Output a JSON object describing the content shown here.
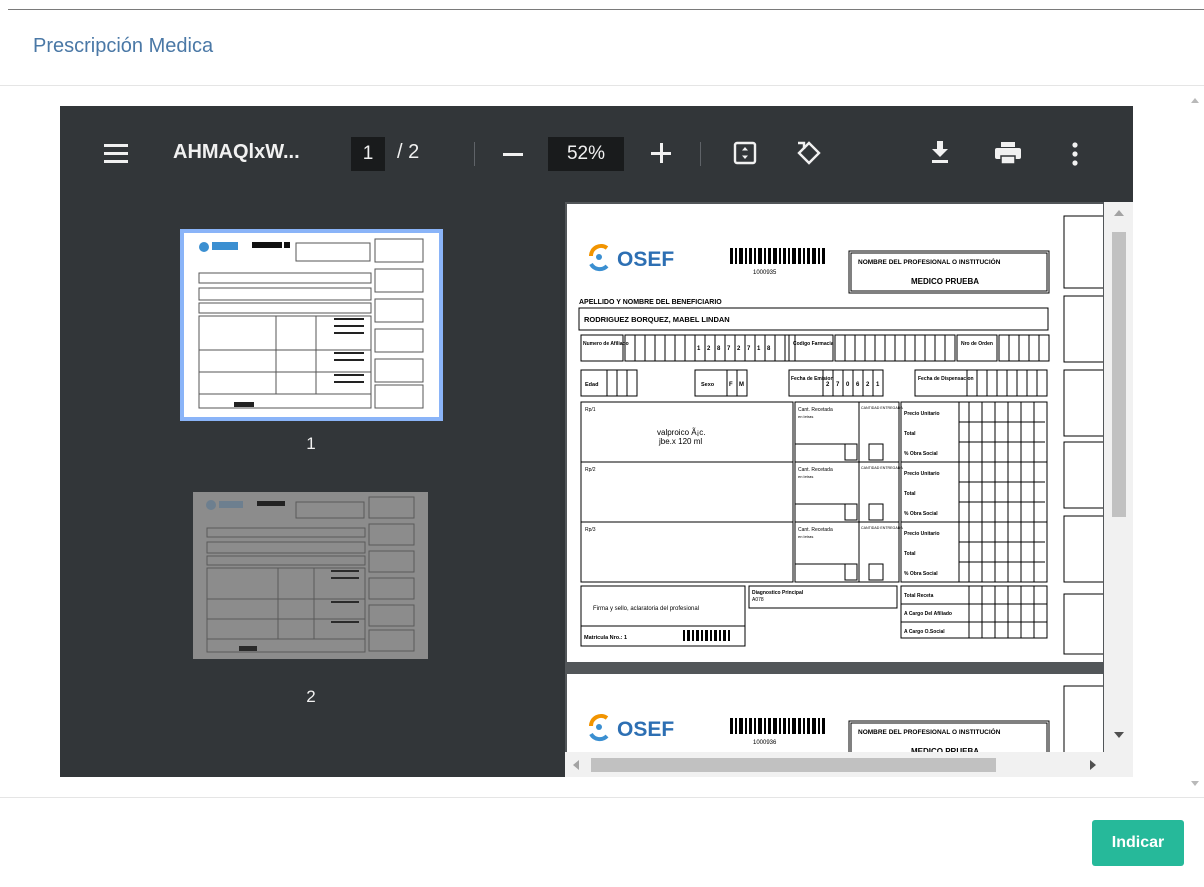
{
  "modal": {
    "title": "Prescripción Medica",
    "submit_label": "Indicar"
  },
  "viewer": {
    "doc_title": "AHMAQlxW...",
    "current_page": "1",
    "page_total": "/ 2",
    "zoom": "52%",
    "thumbnails": [
      {
        "label": "1"
      },
      {
        "label": "2"
      }
    ],
    "icons": [
      "menu-icon",
      "zoom-out-icon",
      "zoom-in-icon",
      "fit-page-icon",
      "rotate-icon",
      "download-icon",
      "print-icon",
      "more-options-icon"
    ]
  },
  "document": {
    "logo": "OSEF",
    "barcode_number": "1000935",
    "professional_header": "NOMBRE DEL PROFESIONAL O INSTITUCIÓN",
    "professional_name": "MEDICO PRUEBA",
    "beneficiary_label": "APELLIDO Y NOMBRE DEL BENEFICIARIO",
    "beneficiary_name": "RODRIGUEZ BORQUEZ, MABEL LINDAN",
    "affiliate_label": "Numero de Afiliado",
    "affiliate_digits": [
      "1",
      "2",
      "8",
      "7",
      "2",
      "7",
      "1",
      "8"
    ],
    "pharmacy_label": "Codigo Farmacia",
    "order_label": "Nro de Orden",
    "age_label": "Edad",
    "sex_label": "Sexo",
    "sex_options": [
      "F",
      "M"
    ],
    "issue_date_label": "Fecha de Emision",
    "issue_date_digits": [
      "2",
      "7",
      "0",
      "6",
      "2",
      "1"
    ],
    "dispense_date_label": "Fecha de Dispensacion",
    "rx_labels": [
      "Rp/1",
      "Rp/2",
      "Rp/3"
    ],
    "medication_line1": "valproico Ã¡c.",
    "medication_line2": "jbe.x 120 ml",
    "qty_label": "Cant. Recetada",
    "qty_sub": "en letras",
    "qty_delivered_label": "CANTIDAD ENTREGADA",
    "unit_price_label": "Precio Unitario",
    "total_label": "Total",
    "social_pct_label": "% Obra Social",
    "diagnosis_label": "Diagnostico Principal",
    "diagnosis_code": "A078",
    "signature_label": "Firma y sello, aclaratoria del profesional",
    "receipt_total_label": "Total Receta",
    "affiliate_charge_label": "A Cargo Del Afiliado",
    "social_charge_label": "A Cargo O.Social",
    "registration_label": "Matricula Nro.: 1",
    "second_page_barcode_number": "1000936"
  },
  "colors": {
    "accent": "#26b99a",
    "title": "#4a78a6",
    "viewer_bg": "#323639",
    "thumb_highlight": "#8ab4f8"
  }
}
